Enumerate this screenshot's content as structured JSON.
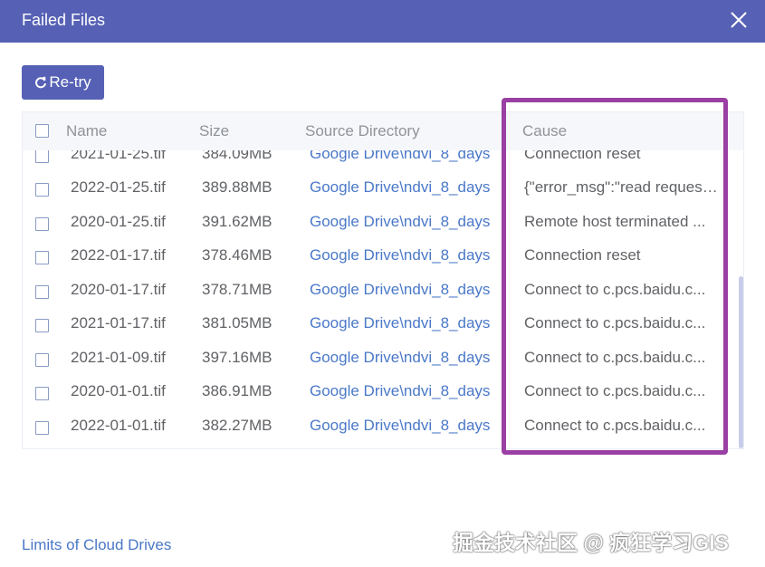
{
  "dialog": {
    "title": "Failed Files"
  },
  "toolbar": {
    "retry_label": "Re-try"
  },
  "table": {
    "columns": [
      "Name",
      "Size",
      "Source Directory",
      "Cause"
    ],
    "rows": [
      {
        "name": "2021-01-25.tif",
        "size": "384.09MB",
        "source": "Google Drive\\ndvi_8_days",
        "cause": "Connection reset"
      },
      {
        "name": "2022-01-25.tif",
        "size": "389.88MB",
        "source": "Google Drive\\ndvi_8_days",
        "cause": "{\"error_msg\":\"read request..."
      },
      {
        "name": "2020-01-25.tif",
        "size": "391.62MB",
        "source": "Google Drive\\ndvi_8_days",
        "cause": "Remote host terminated ..."
      },
      {
        "name": "2022-01-17.tif",
        "size": "378.46MB",
        "source": "Google Drive\\ndvi_8_days",
        "cause": "Connection reset"
      },
      {
        "name": "2020-01-17.tif",
        "size": "378.71MB",
        "source": "Google Drive\\ndvi_8_days",
        "cause": "Connect to c.pcs.baidu.c..."
      },
      {
        "name": "2021-01-17.tif",
        "size": "381.05MB",
        "source": "Google Drive\\ndvi_8_days",
        "cause": "Connect to c.pcs.baidu.c..."
      },
      {
        "name": "2021-01-09.tif",
        "size": "397.16MB",
        "source": "Google Drive\\ndvi_8_days",
        "cause": "Connect to c.pcs.baidu.c..."
      },
      {
        "name": "2020-01-01.tif",
        "size": "386.91MB",
        "source": "Google Drive\\ndvi_8_days",
        "cause": "Connect to c.pcs.baidu.c..."
      },
      {
        "name": "2022-01-01.tif",
        "size": "382.27MB",
        "source": "Google Drive\\ndvi_8_days",
        "cause": "Connect to c.pcs.baidu.c..."
      }
    ]
  },
  "footer": {
    "link_label": "Limits of Cloud Drives"
  },
  "watermark": "掘金技术社区 @ 疯狂学习GIS",
  "colors": {
    "header_bg": "#5661b5",
    "accent": "#5661b5",
    "link": "#4a78c8",
    "highlight": "#9a3fa3"
  },
  "icons": {
    "close": "close-icon",
    "retry": "refresh-icon",
    "checkbox": "checkbox-icon"
  }
}
